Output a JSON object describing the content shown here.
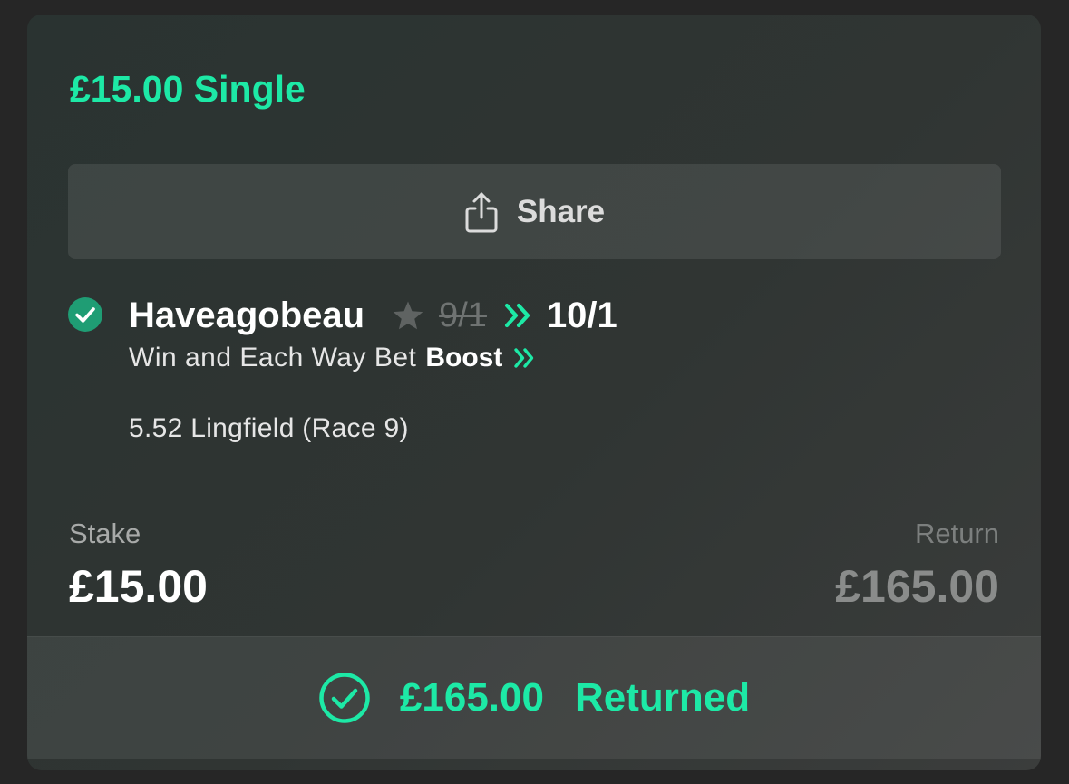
{
  "bet": {
    "title": "£15.00 Single"
  },
  "share": {
    "label": "Share",
    "icon": "share-icon"
  },
  "selection": {
    "status_icon": "check-circle-icon",
    "name": "Haveagobeau",
    "boost_icon": "star-icon",
    "old_odds": "9/1",
    "new_odds": "10/1",
    "market": "Win and Each Way Bet",
    "boost_label": "Boost",
    "event": "5.52 Lingfield (Race 9)"
  },
  "stake": {
    "label": "Stake",
    "value": "£15.00"
  },
  "return": {
    "label": "Return",
    "value": "£165.00"
  },
  "result": {
    "amount": "£165.00",
    "status": "Returned",
    "icon": "check-circle-outline-icon"
  },
  "colors": {
    "accent": "#1de9a6",
    "check_fill": "#1f9d74",
    "card_bg": "#303533",
    "page_bg": "#262626"
  }
}
